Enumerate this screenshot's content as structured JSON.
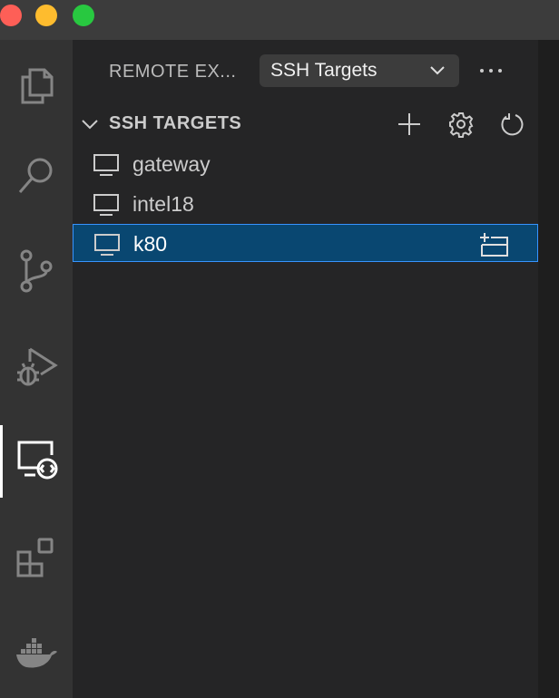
{
  "window": {
    "traffic_lights": {
      "close_color": "#fe5f57",
      "minimize_color": "#febc2e",
      "zoom_color": "#28c840"
    }
  },
  "activity_bar": {
    "items": [
      {
        "icon": "explorer-icon",
        "active": false
      },
      {
        "icon": "search-icon",
        "active": false
      },
      {
        "icon": "source-control-icon",
        "active": false
      },
      {
        "icon": "run-debug-icon",
        "active": false
      },
      {
        "icon": "remote-explorer-icon",
        "active": true
      },
      {
        "icon": "extensions-icon",
        "active": false
      },
      {
        "icon": "docker-icon",
        "active": false
      }
    ]
  },
  "sidebar": {
    "title": "REMOTE EX...",
    "dropdown": {
      "selected": "SSH Targets",
      "icon": "chevron-down-icon"
    },
    "more_icon": "ellipsis-icon",
    "section": {
      "title": "SSH TARGETS",
      "actions": [
        {
          "icon": "plus-icon",
          "label": "Add New"
        },
        {
          "icon": "gear-icon",
          "label": "Configure"
        },
        {
          "icon": "refresh-icon",
          "label": "Refresh"
        }
      ],
      "targets": [
        {
          "label": "gateway",
          "icon": "monitor-icon",
          "selected": false
        },
        {
          "label": "intel18",
          "icon": "monitor-icon",
          "selected": false
        },
        {
          "label": "k80",
          "icon": "monitor-icon",
          "selected": true,
          "action_icon": "connect-in-new-window-icon"
        }
      ]
    }
  },
  "colors": {
    "accent": "#3794ff",
    "selection_background": "#094771",
    "sidebar_background": "#252526",
    "activity_bar_background": "#333333"
  }
}
